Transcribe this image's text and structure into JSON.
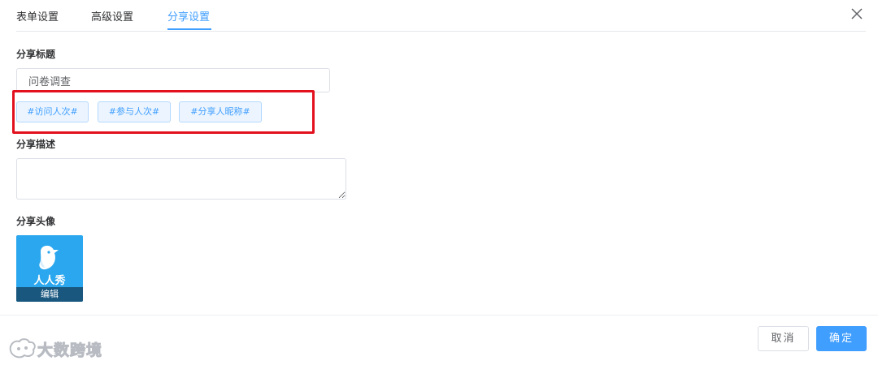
{
  "tabs": [
    {
      "label": "表单设置"
    },
    {
      "label": "高级设置"
    },
    {
      "label": "分享设置",
      "active": true
    }
  ],
  "share_title": {
    "label": "分享标题",
    "value": "问卷调查"
  },
  "tags": [
    {
      "label": "#访问人次#"
    },
    {
      "label": "#参与人次#"
    },
    {
      "label": "#分享人昵称#"
    }
  ],
  "share_desc": {
    "label": "分享描述",
    "value": ""
  },
  "share_avatar": {
    "label": "分享头像",
    "logo_text": "人人秀",
    "edit_label": "编辑"
  },
  "footer": {
    "cancel_label": "取消",
    "confirm_label": "确定"
  },
  "watermark": {
    "text": "大数跨境"
  },
  "colors": {
    "accent": "#409eff",
    "highlight": "#e3101e",
    "avatar_bg": "#2aa7ee"
  },
  "icons": {
    "close": "close-icon",
    "avatar": "bird-logo-icon"
  }
}
